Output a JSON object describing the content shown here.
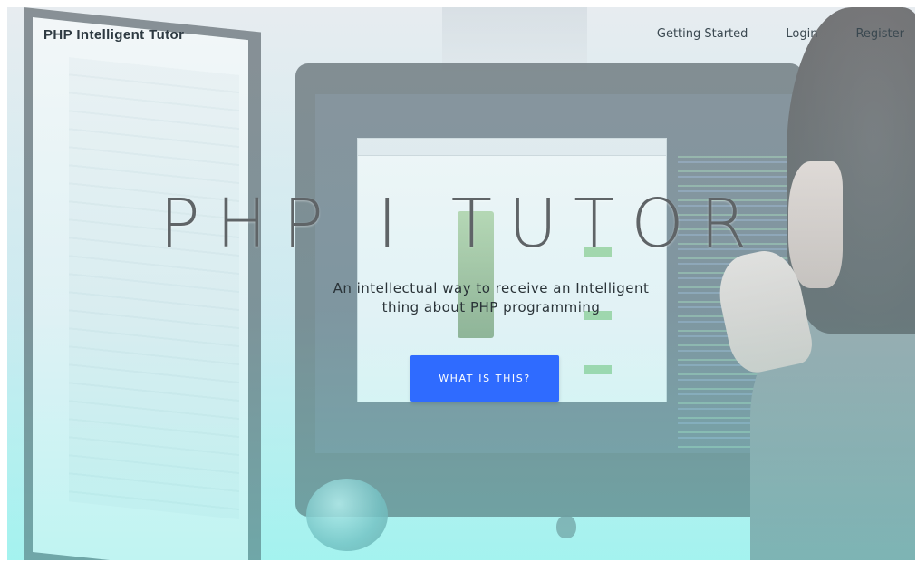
{
  "navbar": {
    "brand": "PHP Intelligent Tutor",
    "links": [
      {
        "label": "Getting Started"
      },
      {
        "label": "Login"
      },
      {
        "label": "Register"
      }
    ]
  },
  "hero": {
    "title": "PHP I TUTOR",
    "subtitle_line1": "An intellectual way to receive an Intelligent",
    "subtitle_line2": "thing about PHP programming",
    "cta_label": "WHAT IS THIS?"
  },
  "colors": {
    "cta_background": "#2f6bff",
    "cta_text": "#ffffff",
    "title_text": "#5f6467"
  }
}
